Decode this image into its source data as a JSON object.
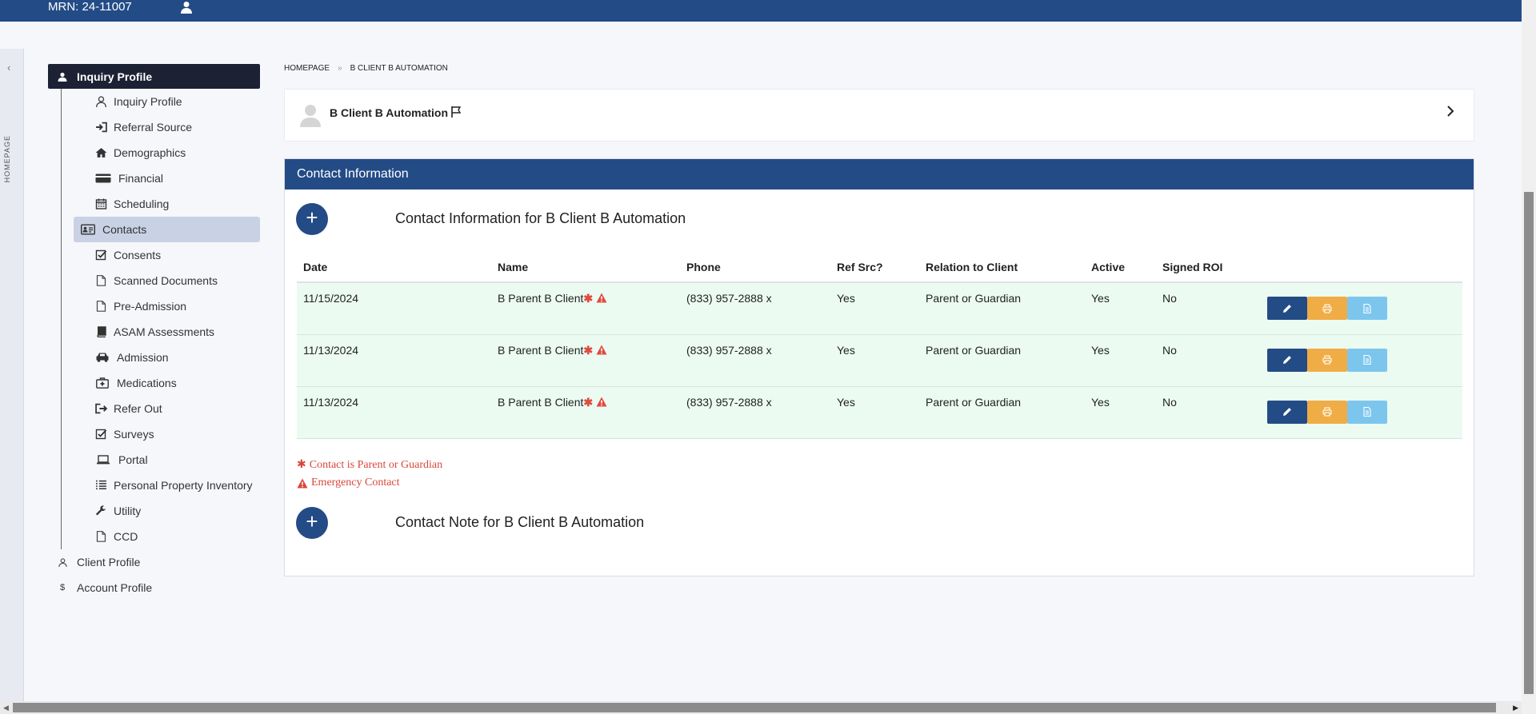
{
  "topbar": {
    "mrn": "MRN: 24-11007",
    "user_icon": "user-icon"
  },
  "rail": {
    "label": "HOMEPAGE",
    "collapse_icon": "chevron-left-icon"
  },
  "nav": {
    "header": "Inquiry Profile",
    "items": [
      {
        "label": "Inquiry Profile",
        "icon": "user-icon"
      },
      {
        "label": "Referral Source",
        "icon": "sign-in-icon"
      },
      {
        "label": "Demographics",
        "icon": "home-icon"
      },
      {
        "label": "Financial",
        "icon": "credit-card-icon"
      },
      {
        "label": "Scheduling",
        "icon": "calendar-icon"
      },
      {
        "label": "Contacts",
        "icon": "address-card-icon"
      },
      {
        "label": "Consents",
        "icon": "checkbox-icon"
      },
      {
        "label": "Scanned Documents",
        "icon": "file-icon"
      },
      {
        "label": "Pre-Admission",
        "icon": "file-icon"
      },
      {
        "label": "ASAM Assessments",
        "icon": "book-icon"
      },
      {
        "label": "Admission",
        "icon": "car-icon"
      },
      {
        "label": "Medications",
        "icon": "medkit-icon"
      },
      {
        "label": "Refer Out",
        "icon": "sign-out-icon"
      },
      {
        "label": "Surveys",
        "icon": "checkbox-icon"
      },
      {
        "label": "Portal",
        "icon": "laptop-icon"
      },
      {
        "label": "Personal Property Inventory",
        "icon": "list-icon"
      },
      {
        "label": "Utility",
        "icon": "wrench-icon"
      },
      {
        "label": "CCD",
        "icon": "file-icon"
      }
    ],
    "lower": [
      {
        "label": "Client Profile",
        "icon": "user-icon"
      },
      {
        "label": "Account Profile",
        "icon": "dollar-icon",
        "glyph": "$"
      }
    ]
  },
  "breadcrumb": {
    "home": "HOMEPAGE",
    "sep": "»",
    "current": "B CLIENT B AUTOMATION"
  },
  "client": {
    "name": "B Client B Automation"
  },
  "panel": {
    "title": "Contact Information",
    "add_glyph": "+",
    "section_title": "Contact Information for B Client B Automation",
    "note_title": "Contact Note for B Client B Automation"
  },
  "table": {
    "headers": [
      "Date",
      "Name",
      "Phone",
      "Ref Src?",
      "Relation to Client",
      "Active",
      "Signed ROI"
    ],
    "rows": [
      {
        "date": "11/15/2024",
        "name": "B Parent B Client",
        "phone": "(833) 957-2888 x",
        "ref": "Yes",
        "relation": "Parent or Guardian",
        "active": "Yes",
        "roi": "No"
      },
      {
        "date": "11/13/2024",
        "name": "B Parent B Client",
        "phone": "(833) 957-2888 x",
        "ref": "Yes",
        "relation": "Parent or Guardian",
        "active": "Yes",
        "roi": "No"
      },
      {
        "date": "11/13/2024",
        "name": "B Parent B Client",
        "phone": "(833) 957-2888 x",
        "ref": "Yes",
        "relation": "Parent or Guardian",
        "active": "Yes",
        "roi": "No"
      }
    ]
  },
  "legend": {
    "asterisk": "✱",
    "parent": "Contact is Parent or Guardian",
    "emergency": "Emergency Contact"
  },
  "colors": {
    "brand": "#234b86",
    "print": "#f0ac45",
    "doc": "#7cc6ee",
    "alert": "#e04a3f",
    "row_bg": "#ebfbf1"
  }
}
